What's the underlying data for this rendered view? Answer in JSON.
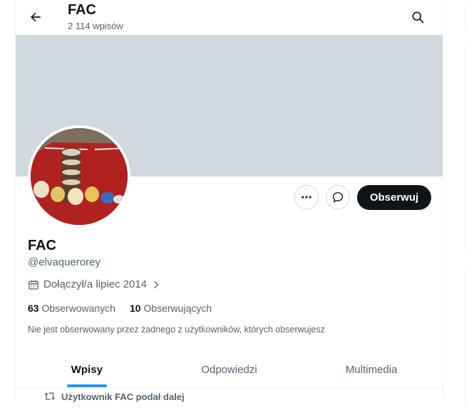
{
  "header": {
    "title": "FAC",
    "post_count": "2 114 wpisów"
  },
  "profile": {
    "name": "FAC",
    "handle": "@elvaquerorey",
    "joined": "Dołączył/a lipiec 2014",
    "following_count": "63",
    "following_label": "Obserwowanych",
    "followers_count": "10",
    "followers_label": "Obserwujących",
    "followed_note": "Nie jest obserwowany przez żadnego z użytkowników, których obserwujesz"
  },
  "actions": {
    "follow_label": "Obserwuj"
  },
  "tabs": [
    {
      "label": "Wpisy"
    },
    {
      "label": "Odpowiedzi"
    },
    {
      "label": "Multimedia"
    }
  ],
  "feed": {
    "repost_label": "Użytkownik FAC podał dalej"
  },
  "colors": {
    "accent": "#1d9bf0",
    "text": "#0f1419",
    "muted": "#536471",
    "banner": "#cfd9de"
  },
  "icons": [
    "back-arrow-icon",
    "search-icon",
    "more-icon",
    "message-icon",
    "calendar-icon",
    "chevron-right-icon",
    "repost-icon"
  ]
}
